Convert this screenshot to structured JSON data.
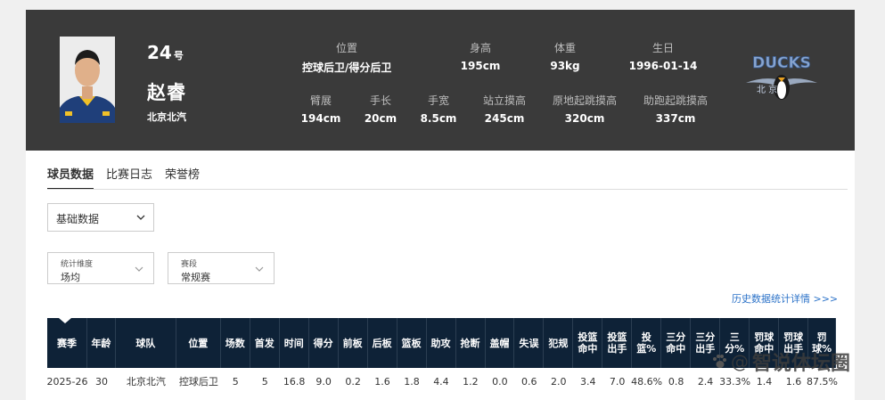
{
  "player": {
    "number": "24",
    "number_suffix": "号",
    "name": "赵睿",
    "team": "北京北汽"
  },
  "info_row1": [
    {
      "label": "位置",
      "value": "控球后卫/得分后卫"
    },
    {
      "label": "身高",
      "value": "195cm"
    },
    {
      "label": "体重",
      "value": "93kg"
    },
    {
      "label": "生日",
      "value": "1996-01-14"
    }
  ],
  "info_row2": [
    {
      "label": "臂展",
      "value": "194cm"
    },
    {
      "label": "手长",
      "value": "20cm"
    },
    {
      "label": "手宽",
      "value": "8.5cm"
    },
    {
      "label": "站立摸高",
      "value": "245cm"
    },
    {
      "label": "原地起跳摸高",
      "value": "320cm"
    },
    {
      "label": "助跑起跳摸高",
      "value": "337cm"
    }
  ],
  "logo": {
    "text": "DUCKS",
    "sub": "北 京"
  },
  "tabs": [
    "球员数据",
    "比赛日志",
    "荣誉榜"
  ],
  "stat_type_select": {
    "value": "基础数据"
  },
  "dimension_select": {
    "label": "统计维度",
    "value": "场均"
  },
  "stage_select": {
    "label": "赛段",
    "value": "常规赛"
  },
  "history_link": "历史数据统计详情 >>>",
  "table": {
    "headers": [
      "赛季",
      "年龄",
      "球队",
      "位置",
      "场数",
      "首发",
      "时间",
      "得分",
      "前板",
      "后板",
      "篮板",
      "助攻",
      "抢断",
      "盖帽",
      "失误",
      "犯规",
      "投篮命中",
      "投篮出手",
      "投篮%",
      "三分命中",
      "三分出手",
      "三分%",
      "罚球命中",
      "罚球出手",
      "罚球%"
    ],
    "rows": [
      [
        "2025-26",
        "30",
        "北京北汽",
        "控球后卫",
        "5",
        "5",
        "16.8",
        "9.0",
        "0.2",
        "1.6",
        "1.8",
        "4.4",
        "1.2",
        "0.0",
        "0.6",
        "2.0",
        "3.4",
        "7.0",
        "48.6%",
        "0.8",
        "2.4",
        "33.3%",
        "1.4",
        "1.6",
        "87.5%"
      ]
    ]
  },
  "watermark": {
    "at": "@",
    "text": "智说体坛圈"
  },
  "colors": {
    "header_bg": "#3a3a3a",
    "table_header_bg": "#0e2237",
    "link": "#2b72c8"
  }
}
